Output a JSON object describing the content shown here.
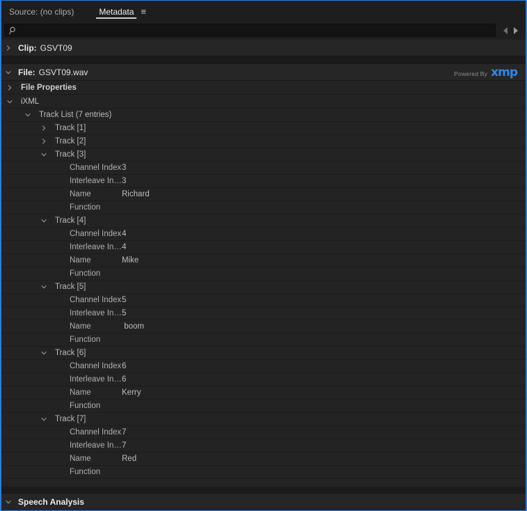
{
  "panel": {
    "accent_color": "#2a7de1",
    "background_color": "#232323"
  },
  "tabs": [
    {
      "label": "Source: (no clips)",
      "active": false,
      "name": "tab-source"
    },
    {
      "label": "Metadata",
      "active": true,
      "name": "tab-metadata"
    }
  ],
  "tab_menu_icon": "≡",
  "search": {
    "value": "",
    "placeholder": "",
    "icon": "search-icon"
  },
  "nav": {
    "prev_icon": "triangle-left-icon",
    "next_icon": "triangle-right-icon"
  },
  "branding": {
    "powered_by": "Powered By",
    "wordmark": "xmp",
    "color": "#2f86e8"
  },
  "sections": {
    "clip": {
      "title_key": "Clip:",
      "title_value": "GSVT09",
      "expanded": false
    },
    "file": {
      "title_key": "File:",
      "title_value": "GSVT09.wav",
      "expanded": true
    },
    "file_properties": {
      "label": "File Properties",
      "expanded": false
    },
    "ixml": {
      "label": "iXML",
      "expanded": true
    },
    "track_list": {
      "label": "Track List (7 entries)",
      "expanded": true
    },
    "speech_analysis": {
      "label": "Speech Analysis",
      "expanded": true
    }
  },
  "property_labels": {
    "channel_index": "Channel Index",
    "interleave_index": "Interleave In…",
    "name": "Name",
    "function": "Function"
  },
  "tracks": [
    {
      "label": "Track [1]",
      "expanded": false,
      "channel_index": "",
      "interleave_index": "",
      "name": "",
      "function": ""
    },
    {
      "label": "Track [2]",
      "expanded": false,
      "channel_index": "",
      "interleave_index": "",
      "name": "",
      "function": ""
    },
    {
      "label": "Track [3]",
      "expanded": true,
      "channel_index": "3",
      "interleave_index": "3",
      "name": "Richard",
      "function": ""
    },
    {
      "label": "Track [4]",
      "expanded": true,
      "channel_index": "4",
      "interleave_index": "4",
      "name": "Mike",
      "function": ""
    },
    {
      "label": "Track [5]",
      "expanded": true,
      "channel_index": "5",
      "interleave_index": "5",
      "name": " boom",
      "function": ""
    },
    {
      "label": "Track [6]",
      "expanded": true,
      "channel_index": "6",
      "interleave_index": "6",
      "name": "Kerry",
      "function": ""
    },
    {
      "label": "Track [7]",
      "expanded": true,
      "channel_index": "7",
      "interleave_index": "7",
      "name": "Red",
      "function": ""
    }
  ]
}
